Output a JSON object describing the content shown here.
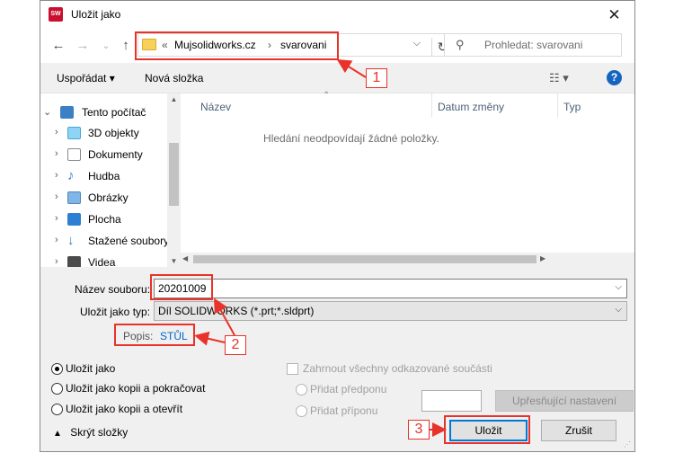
{
  "window": {
    "title": "Uložit jako",
    "app_icon_text": "SW\n2020"
  },
  "address": {
    "crumbs": [
      "Mujsolidworks.cz",
      "svarovani"
    ],
    "prefix": "«"
  },
  "search": {
    "placeholder": "Prohledat: svarovani"
  },
  "toolbar": {
    "organize_label": "Uspořádat ▾",
    "new_folder_label": "Nová složka"
  },
  "sidebar": {
    "items": [
      {
        "label": "Tento počítač",
        "icon": "computer-icon"
      },
      {
        "label": "3D objekty",
        "icon": "cube-icon"
      },
      {
        "label": "Dokumenty",
        "icon": "document-icon"
      },
      {
        "label": "Hudba",
        "icon": "music-icon"
      },
      {
        "label": "Obrázky",
        "icon": "picture-icon"
      },
      {
        "label": "Plocha",
        "icon": "desktop-icon"
      },
      {
        "label": "Stažené soubory",
        "icon": "download-icon"
      },
      {
        "label": "Videa",
        "icon": "video-icon"
      }
    ]
  },
  "filelist": {
    "columns": [
      "Název",
      "Datum změny",
      "Typ"
    ],
    "empty_message": "Hledání neodpovídají žádné položky."
  },
  "form": {
    "filename_label": "Název souboru:",
    "filename_value": "20201009",
    "filetype_label": "Uložit jako typ:",
    "filetype_value": "Díl SOLIDWORKS (*.prt;*.sldprt)",
    "popis_label": "Popis:",
    "popis_value": "STŮL"
  },
  "options": {
    "save_as": "Uložit jako",
    "save_copy_continue": "Uložit jako kopii a pokračovat",
    "save_copy_open": "Uložit jako kopii a otevřít",
    "include_refs": "Zahrnout všechny odkazované součásti",
    "add_prefix": "Přidat předponu",
    "add_suffix": "Přidat příponu"
  },
  "buttons": {
    "advanced": "Upřesňující nastavení",
    "save": "Uložit",
    "cancel": "Zrušit"
  },
  "footer": {
    "hide_folders": "Skrýt složky"
  },
  "annotations": {
    "callout_1": "1",
    "callout_2": "2",
    "callout_3": "3"
  },
  "colors": {
    "annotation": "#e8332a",
    "accent": "#0078d7"
  }
}
